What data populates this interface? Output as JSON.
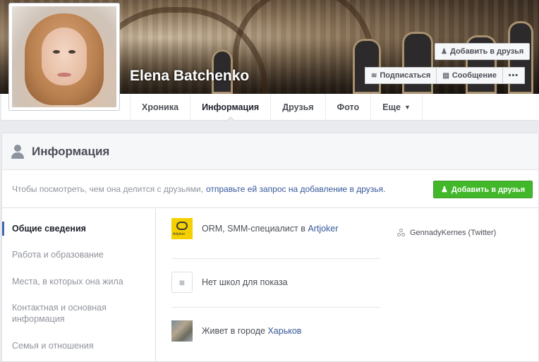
{
  "profile": {
    "name": "Elena Batchenko"
  },
  "header_buttons": {
    "add_friend": "Добавить в друзья",
    "follow": "Подписаться",
    "message": "Сообщение",
    "more": "•••"
  },
  "tabs": [
    {
      "label": "Хроника"
    },
    {
      "label": "Информация"
    },
    {
      "label": "Друзья"
    },
    {
      "label": "Фото"
    },
    {
      "label": "Еще"
    }
  ],
  "panel": {
    "title": "Информация",
    "notice_text": "Чтобы посмотреть, чем она делится с друзьями,",
    "notice_link": "отправьте ей запрос на добавление в друзья.",
    "add_friend_button": "Добавить в друзья"
  },
  "sidenav": {
    "items": [
      {
        "label": "Общие сведения"
      },
      {
        "label": "Работа и образование"
      },
      {
        "label": "Места, в которых она жила"
      },
      {
        "label": "Контактная и основная информация"
      },
      {
        "label": "Семья и отношения"
      }
    ]
  },
  "overview": {
    "work_prefix": "ORM, SMM-специалист в",
    "work_company": "Artjoker",
    "work_logo_text": "Artjoker",
    "school_text": "Нет школ для показа",
    "city_prefix": "Живет в городе",
    "city_name": "Харьков",
    "source": "GennadyKernes (Twitter)"
  },
  "icons": {
    "add_friend": "person-plus-icon",
    "follow": "rss-icon",
    "message": "chat-bubbles-icon",
    "dropdown": "caret-down-icon",
    "section": "person-icon",
    "school": "school-icon",
    "source": "share-network-icon"
  },
  "colors": {
    "link": "#365899",
    "green_button": "#42b72a",
    "active_nav": "#4267b2"
  }
}
